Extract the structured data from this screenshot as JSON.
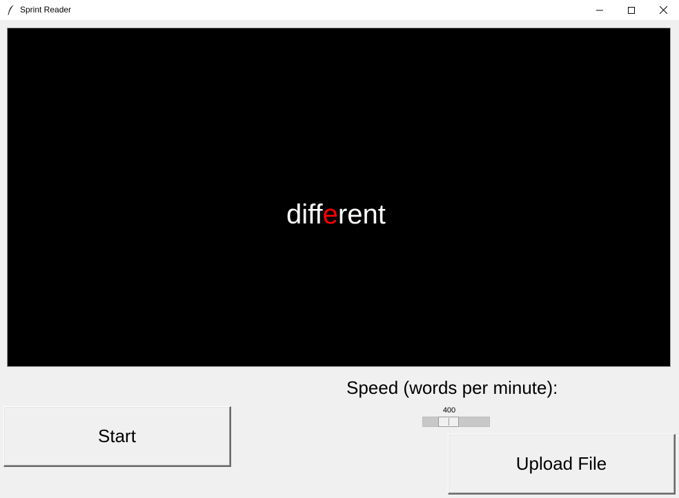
{
  "window": {
    "title": "Sprint Reader",
    "icon": "feather-icon",
    "controls": [
      "minimize-icon",
      "maximize-icon",
      "close-icon"
    ]
  },
  "display": {
    "background": "#000000",
    "word_before": "diff",
    "word_focus": "e",
    "word_after": "rent",
    "word_color": "#ffffff",
    "focus_color": "#ff0000"
  },
  "speed": {
    "label": "Speed (words per minute):",
    "value": "400"
  },
  "buttons": {
    "start_label": "Start",
    "upload_label": "Upload File"
  }
}
